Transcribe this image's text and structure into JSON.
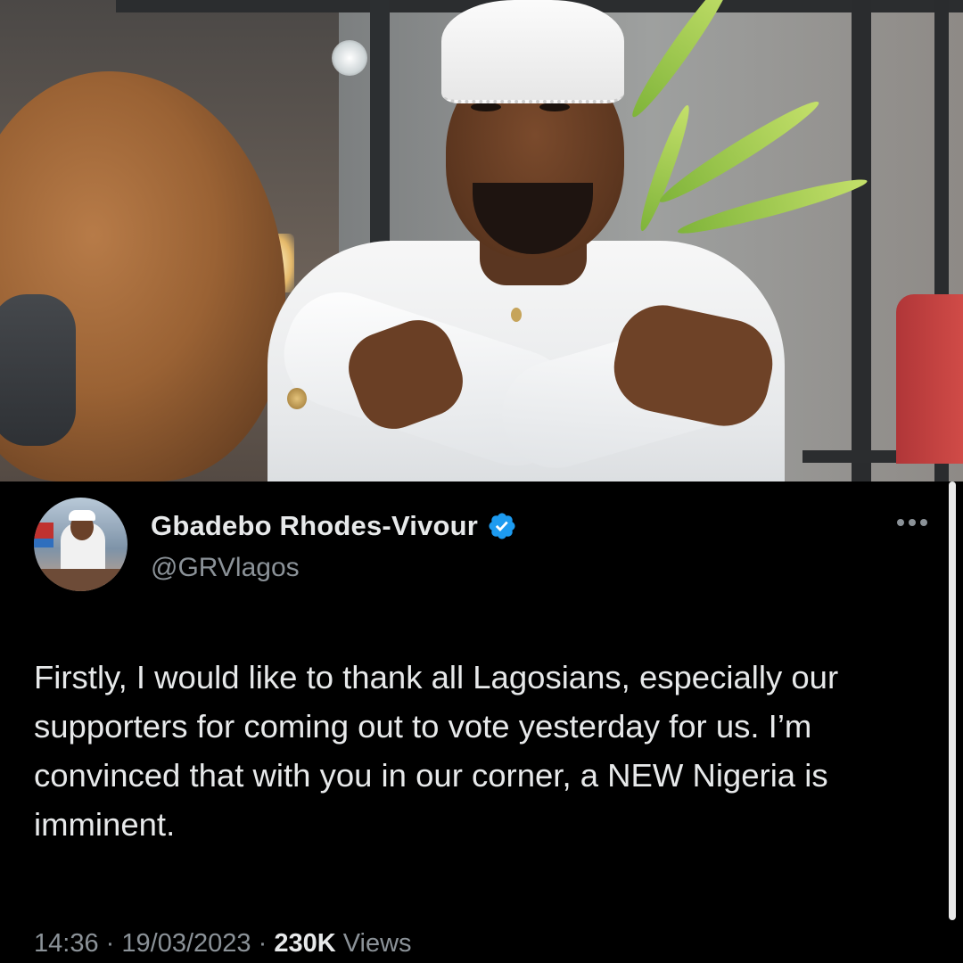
{
  "photo": {
    "icon": "portrait-photo"
  },
  "tweet": {
    "display_name": "Gbadebo Rhodes-Vivour",
    "handle": "@GRVlagos",
    "verified": true,
    "text": "Firstly, I would like to thank all Lagosians, especially our supporters for coming out to vote yesterday for us. I’m convinced that with you in our corner, a NEW Nigeria is imminent.",
    "time": "14:36",
    "separator": "·",
    "date": "19/03/2023",
    "views_count": "230K",
    "views_label": "Views"
  },
  "colors": {
    "background": "#000000",
    "primary_text": "#e7e9ea",
    "secondary_text": "#8b9298",
    "verified_blue": "#1d9bf0"
  }
}
